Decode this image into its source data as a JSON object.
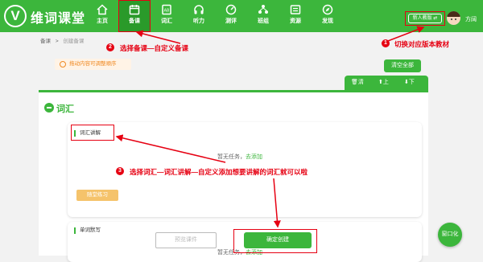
{
  "app": {
    "logo_letter": "V",
    "brand": "维词课堂"
  },
  "nav": {
    "items": [
      {
        "label": "主页"
      },
      {
        "label": "备课"
      },
      {
        "label": "词汇"
      },
      {
        "label": "听力"
      },
      {
        "label": "测评"
      },
      {
        "label": "班组"
      },
      {
        "label": "资源"
      },
      {
        "label": "发现"
      }
    ],
    "active": "备课"
  },
  "header": {
    "version_button": "新人教版 ⇄",
    "username": "方阔"
  },
  "breadcrumb": {
    "root": "备课",
    "separator": ">",
    "current": "创建备课"
  },
  "hint": {
    "text": "拖动内容可调整顺序"
  },
  "actions": {
    "clear_all": "清空全部"
  },
  "toolbar": {
    "clear": "清空",
    "move_up": "上移",
    "move_down": "下移"
  },
  "section": {
    "title": "词汇"
  },
  "card1": {
    "title": "词汇讲解",
    "empty_text": "暂无任务，",
    "add_link": "去添加",
    "practice_button": "随堂练习"
  },
  "card2": {
    "title": "单词默写",
    "empty_text": "暂无任务，",
    "add_link": "去添加",
    "preview_button": "预览课件",
    "create_button": "确定创建"
  },
  "float_button": {
    "label": "窗口化"
  },
  "annotations": {
    "a1": {
      "num": "1",
      "text": "切换对应版本教材"
    },
    "a2": {
      "num": "2",
      "text": "选择备课—自定义备课"
    },
    "a3": {
      "num": "3",
      "text": "选择词汇—词汇讲解—自定义添加想要讲解的词汇就可以啦"
    }
  },
  "colors": {
    "primary": "#3cb63c",
    "annotation": "#e60012",
    "hint": "#f08a24",
    "practice": "#f5c36b"
  }
}
